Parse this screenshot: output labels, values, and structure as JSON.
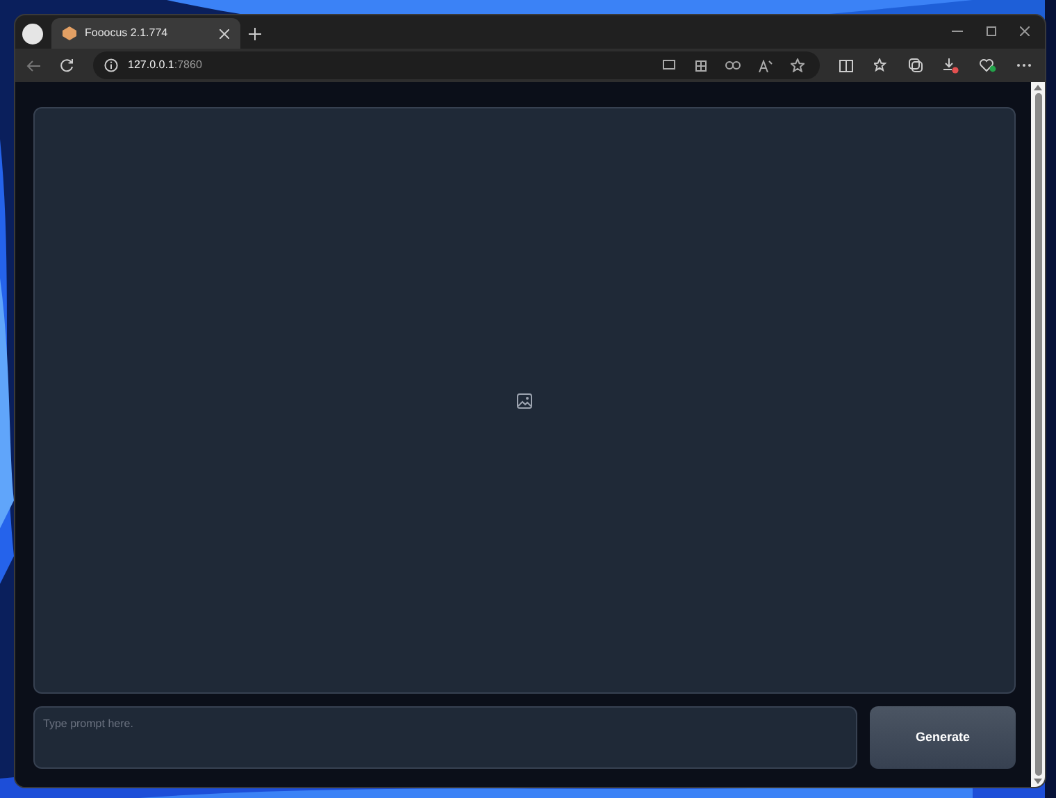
{
  "browser": {
    "tab": {
      "title": "Fooocus 2.1.774",
      "selected": true
    },
    "address": {
      "host": "127.0.0.1",
      "port": ":7860"
    }
  },
  "page": {
    "image_panel": {
      "empty": true
    },
    "prompt": {
      "placeholder": "Type prompt here."
    },
    "generate_button": {
      "label": "Generate"
    }
  }
}
